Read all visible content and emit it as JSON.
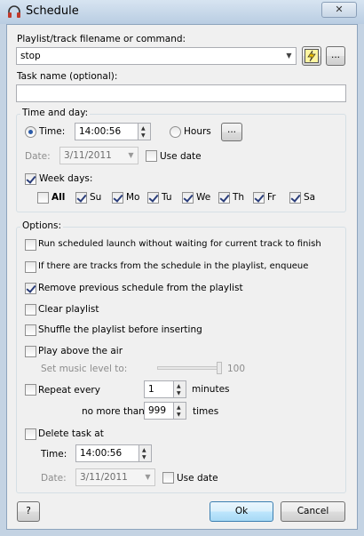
{
  "window": {
    "title": "Schedule",
    "close_glyph": "✕"
  },
  "command": {
    "label": "Playlist/track filename or command:",
    "value": "stop",
    "ellipsis": "..."
  },
  "task": {
    "label": "Task name (optional):",
    "value": ""
  },
  "time_day": {
    "title": "Time and day:",
    "time_label": "Time:",
    "time_value": "14:00:56",
    "hours_label": "Hours",
    "hours_button": "...",
    "date_label": "Date:",
    "date_value": "3/11/2011",
    "use_date": "Use date",
    "week_days_label": "Week days:",
    "days": [
      "All",
      "Su",
      "Mo",
      "Tu",
      "We",
      "Th",
      "Fr",
      "Sa"
    ]
  },
  "options": {
    "title": "Options:",
    "run_scheduled": "Run scheduled launch without waiting for current track to finish",
    "enqueue": "If there are tracks from the schedule in the playlist, enqueue",
    "remove_previous": "Remove previous schedule from the playlist",
    "clear_playlist": "Clear playlist",
    "shuffle": "Shuffle the playlist before inserting",
    "play_above": "Play above the air",
    "music_level_label": "Set music level to:",
    "music_level_value": "100",
    "repeat_label": "Repeat every",
    "repeat_value": "1",
    "minutes": "minutes",
    "no_more_than": "no more than",
    "times_value": "999",
    "times": "times",
    "delete_task": "Delete task at",
    "delete_time_label": "Time:",
    "delete_time_value": "14:00:56",
    "delete_date_label": "Date:",
    "delete_date_value": "3/11/2011",
    "delete_use_date": "Use date"
  },
  "footer": {
    "help": "?",
    "ok": "Ok",
    "cancel": "Cancel"
  }
}
